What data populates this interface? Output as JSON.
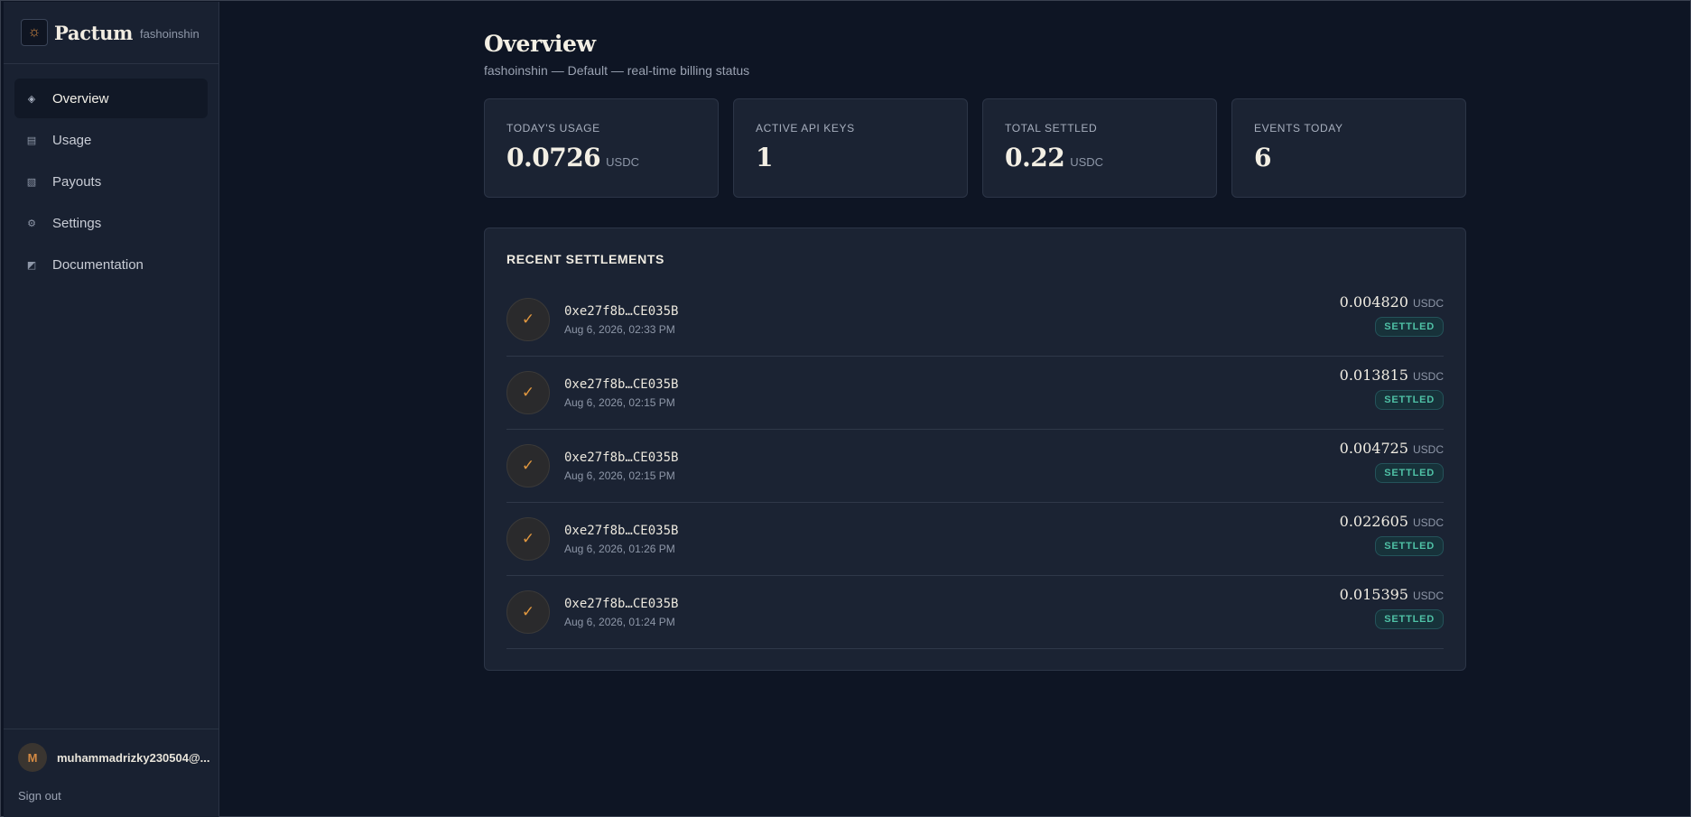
{
  "brand": {
    "name": "Pactum",
    "workspace": "fashoinshin",
    "logo_icon": "logo-icon"
  },
  "nav": [
    {
      "label": "Overview",
      "icon": "◈",
      "name": "sidebar-item-overview",
      "active": true
    },
    {
      "label": "Usage",
      "icon": "▤",
      "name": "sidebar-item-usage",
      "active": false
    },
    {
      "label": "Payouts",
      "icon": "▧",
      "name": "sidebar-item-payouts",
      "active": false
    },
    {
      "label": "Settings",
      "icon": "⚙",
      "name": "sidebar-item-settings",
      "active": false
    },
    {
      "label": "Documentation",
      "icon": "◩",
      "name": "sidebar-item-documentation",
      "active": false
    }
  ],
  "user": {
    "initial": "M",
    "email": "muhammadrizky230504@...",
    "signout_label": "Sign out"
  },
  "page": {
    "title": "Overview",
    "subtitle": "fashoinshin — Default — real-time billing status"
  },
  "stats": [
    {
      "label": "TODAY'S USAGE",
      "value": "0.0726",
      "unit": "USDC"
    },
    {
      "label": "ACTIVE API KEYS",
      "value": "1",
      "unit": ""
    },
    {
      "label": "TOTAL SETTLED",
      "value": "0.22",
      "unit": "USDC"
    },
    {
      "label": "EVENTS TODAY",
      "value": "6",
      "unit": ""
    }
  ],
  "settlements": {
    "title": "RECENT SETTLEMENTS",
    "rows": [
      {
        "address": "0xe27f8b…CE035B",
        "time": "Aug 6, 2026, 02:33 PM",
        "amount": "0.004820",
        "unit": "USDC",
        "status": "SETTLED"
      },
      {
        "address": "0xe27f8b…CE035B",
        "time": "Aug 6, 2026, 02:15 PM",
        "amount": "0.013815",
        "unit": "USDC",
        "status": "SETTLED"
      },
      {
        "address": "0xe27f8b…CE035B",
        "time": "Aug 6, 2026, 02:15 PM",
        "amount": "0.004725",
        "unit": "USDC",
        "status": "SETTLED"
      },
      {
        "address": "0xe27f8b…CE035B",
        "time": "Aug 6, 2026, 01:26 PM",
        "amount": "0.022605",
        "unit": "USDC",
        "status": "SETTLED"
      },
      {
        "address": "0xe27f8b…CE035B",
        "time": "Aug 6, 2026, 01:24 PM",
        "amount": "0.015395",
        "unit": "USDC",
        "status": "SETTLED"
      }
    ]
  },
  "colors": {
    "accent": "#e0973f",
    "settled": "#4fc1a6",
    "background": "#0e1524",
    "panel": "#1b2333"
  }
}
